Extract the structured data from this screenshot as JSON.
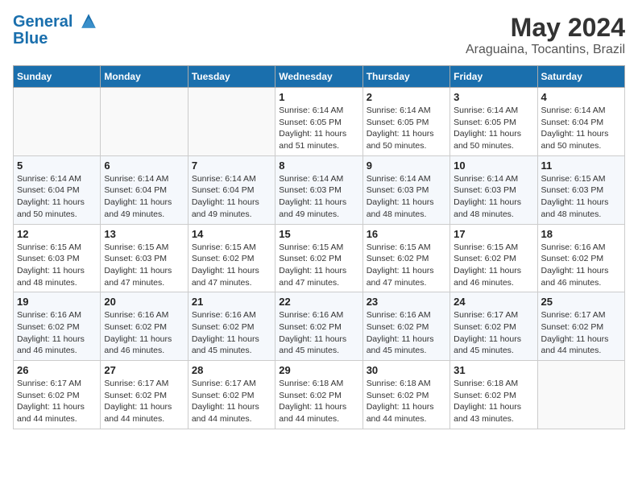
{
  "header": {
    "logo_line1": "General",
    "logo_line2": "Blue",
    "main_title": "May 2024",
    "subtitle": "Araguaina, Tocantins, Brazil"
  },
  "weekdays": [
    "Sunday",
    "Monday",
    "Tuesday",
    "Wednesday",
    "Thursday",
    "Friday",
    "Saturday"
  ],
  "weeks": [
    [
      {
        "day": "",
        "info": ""
      },
      {
        "day": "",
        "info": ""
      },
      {
        "day": "",
        "info": ""
      },
      {
        "day": "1",
        "info": "Sunrise: 6:14 AM\nSunset: 6:05 PM\nDaylight: 11 hours\nand 51 minutes."
      },
      {
        "day": "2",
        "info": "Sunrise: 6:14 AM\nSunset: 6:05 PM\nDaylight: 11 hours\nand 50 minutes."
      },
      {
        "day": "3",
        "info": "Sunrise: 6:14 AM\nSunset: 6:05 PM\nDaylight: 11 hours\nand 50 minutes."
      },
      {
        "day": "4",
        "info": "Sunrise: 6:14 AM\nSunset: 6:04 PM\nDaylight: 11 hours\nand 50 minutes."
      }
    ],
    [
      {
        "day": "5",
        "info": "Sunrise: 6:14 AM\nSunset: 6:04 PM\nDaylight: 11 hours\nand 50 minutes."
      },
      {
        "day": "6",
        "info": "Sunrise: 6:14 AM\nSunset: 6:04 PM\nDaylight: 11 hours\nand 49 minutes."
      },
      {
        "day": "7",
        "info": "Sunrise: 6:14 AM\nSunset: 6:04 PM\nDaylight: 11 hours\nand 49 minutes."
      },
      {
        "day": "8",
        "info": "Sunrise: 6:14 AM\nSunset: 6:03 PM\nDaylight: 11 hours\nand 49 minutes."
      },
      {
        "day": "9",
        "info": "Sunrise: 6:14 AM\nSunset: 6:03 PM\nDaylight: 11 hours\nand 48 minutes."
      },
      {
        "day": "10",
        "info": "Sunrise: 6:14 AM\nSunset: 6:03 PM\nDaylight: 11 hours\nand 48 minutes."
      },
      {
        "day": "11",
        "info": "Sunrise: 6:15 AM\nSunset: 6:03 PM\nDaylight: 11 hours\nand 48 minutes."
      }
    ],
    [
      {
        "day": "12",
        "info": "Sunrise: 6:15 AM\nSunset: 6:03 PM\nDaylight: 11 hours\nand 48 minutes."
      },
      {
        "day": "13",
        "info": "Sunrise: 6:15 AM\nSunset: 6:03 PM\nDaylight: 11 hours\nand 47 minutes."
      },
      {
        "day": "14",
        "info": "Sunrise: 6:15 AM\nSunset: 6:02 PM\nDaylight: 11 hours\nand 47 minutes."
      },
      {
        "day": "15",
        "info": "Sunrise: 6:15 AM\nSunset: 6:02 PM\nDaylight: 11 hours\nand 47 minutes."
      },
      {
        "day": "16",
        "info": "Sunrise: 6:15 AM\nSunset: 6:02 PM\nDaylight: 11 hours\nand 47 minutes."
      },
      {
        "day": "17",
        "info": "Sunrise: 6:15 AM\nSunset: 6:02 PM\nDaylight: 11 hours\nand 46 minutes."
      },
      {
        "day": "18",
        "info": "Sunrise: 6:16 AM\nSunset: 6:02 PM\nDaylight: 11 hours\nand 46 minutes."
      }
    ],
    [
      {
        "day": "19",
        "info": "Sunrise: 6:16 AM\nSunset: 6:02 PM\nDaylight: 11 hours\nand 46 minutes."
      },
      {
        "day": "20",
        "info": "Sunrise: 6:16 AM\nSunset: 6:02 PM\nDaylight: 11 hours\nand 46 minutes."
      },
      {
        "day": "21",
        "info": "Sunrise: 6:16 AM\nSunset: 6:02 PM\nDaylight: 11 hours\nand 45 minutes."
      },
      {
        "day": "22",
        "info": "Sunrise: 6:16 AM\nSunset: 6:02 PM\nDaylight: 11 hours\nand 45 minutes."
      },
      {
        "day": "23",
        "info": "Sunrise: 6:16 AM\nSunset: 6:02 PM\nDaylight: 11 hours\nand 45 minutes."
      },
      {
        "day": "24",
        "info": "Sunrise: 6:17 AM\nSunset: 6:02 PM\nDaylight: 11 hours\nand 45 minutes."
      },
      {
        "day": "25",
        "info": "Sunrise: 6:17 AM\nSunset: 6:02 PM\nDaylight: 11 hours\nand 44 minutes."
      }
    ],
    [
      {
        "day": "26",
        "info": "Sunrise: 6:17 AM\nSunset: 6:02 PM\nDaylight: 11 hours\nand 44 minutes."
      },
      {
        "day": "27",
        "info": "Sunrise: 6:17 AM\nSunset: 6:02 PM\nDaylight: 11 hours\nand 44 minutes."
      },
      {
        "day": "28",
        "info": "Sunrise: 6:17 AM\nSunset: 6:02 PM\nDaylight: 11 hours\nand 44 minutes."
      },
      {
        "day": "29",
        "info": "Sunrise: 6:18 AM\nSunset: 6:02 PM\nDaylight: 11 hours\nand 44 minutes."
      },
      {
        "day": "30",
        "info": "Sunrise: 6:18 AM\nSunset: 6:02 PM\nDaylight: 11 hours\nand 44 minutes."
      },
      {
        "day": "31",
        "info": "Sunrise: 6:18 AM\nSunset: 6:02 PM\nDaylight: 11 hours\nand 43 minutes."
      },
      {
        "day": "",
        "info": ""
      }
    ]
  ]
}
